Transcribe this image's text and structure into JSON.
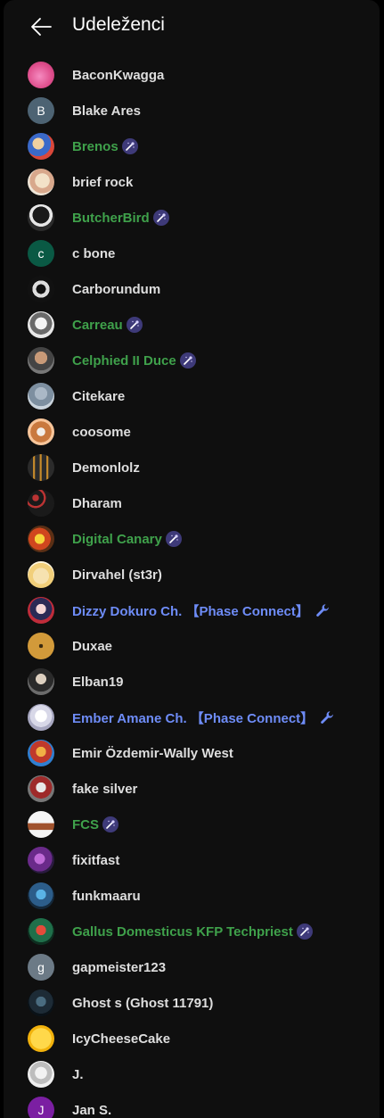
{
  "header": {
    "title": "Udeleženci",
    "back_icon": "arrow-left-icon"
  },
  "colors": {
    "member": "#3fa14b",
    "moderator": "#6e8cf7",
    "default": "#dedede"
  },
  "participants": [
    {
      "name": "BaconKwagga",
      "role": "none",
      "avatar": "pink-image"
    },
    {
      "name": "Blake Ares",
      "role": "none",
      "avatar": "letter",
      "initial": "B",
      "color": "#4d6373"
    },
    {
      "name": "Brenos",
      "role": "member",
      "avatar": "image"
    },
    {
      "name": "brief rock",
      "role": "none",
      "avatar": "image"
    },
    {
      "name": "ButcherBird",
      "role": "member",
      "avatar": "image"
    },
    {
      "name": "c bone",
      "role": "none",
      "avatar": "letter",
      "initial": "c",
      "color": "#0a5944"
    },
    {
      "name": "Carborundum",
      "role": "none",
      "avatar": "image"
    },
    {
      "name": "Carreau",
      "role": "member",
      "avatar": "image"
    },
    {
      "name": "Celphied II Duce",
      "role": "member",
      "avatar": "image"
    },
    {
      "name": "Citekare",
      "role": "none",
      "avatar": "image"
    },
    {
      "name": "coosome",
      "role": "none",
      "avatar": "image"
    },
    {
      "name": "Demonlolz",
      "role": "none",
      "avatar": "image"
    },
    {
      "name": "Dharam",
      "role": "none",
      "avatar": "image"
    },
    {
      "name": "Digital Canary",
      "role": "member",
      "avatar": "image"
    },
    {
      "name": "Dirvahel (st3r)",
      "role": "none",
      "avatar": "image"
    },
    {
      "name": "Dizzy Dokuro Ch. 【Phase Connect】",
      "role": "moderator",
      "avatar": "image"
    },
    {
      "name": "Duxae",
      "role": "none",
      "avatar": "image"
    },
    {
      "name": "Elban19",
      "role": "none",
      "avatar": "image"
    },
    {
      "name": "Ember Amane Ch. 【Phase Connect】",
      "role": "moderator",
      "avatar": "image"
    },
    {
      "name": "Emir Özdemir-Wally West",
      "role": "none",
      "avatar": "image"
    },
    {
      "name": "fake silver",
      "role": "none",
      "avatar": "image"
    },
    {
      "name": "FCS",
      "role": "member",
      "avatar": "image"
    },
    {
      "name": "fixitfast",
      "role": "none",
      "avatar": "image"
    },
    {
      "name": "funkmaaru",
      "role": "none",
      "avatar": "image"
    },
    {
      "name": "Gallus Domesticus KFP Techpriest",
      "role": "member",
      "avatar": "image"
    },
    {
      "name": "gapmeister123",
      "role": "none",
      "avatar": "letter",
      "initial": "g",
      "color": "#6c7a86"
    },
    {
      "name": "Ghost s (Ghost 11791)",
      "role": "none",
      "avatar": "image"
    },
    {
      "name": "IcyCheeseCake",
      "role": "none",
      "avatar": "image"
    },
    {
      "name": "J.",
      "role": "none",
      "avatar": "image"
    },
    {
      "name": "Jan S.",
      "role": "none",
      "avatar": "letter",
      "initial": "J",
      "color": "#7b1fa2"
    }
  ]
}
